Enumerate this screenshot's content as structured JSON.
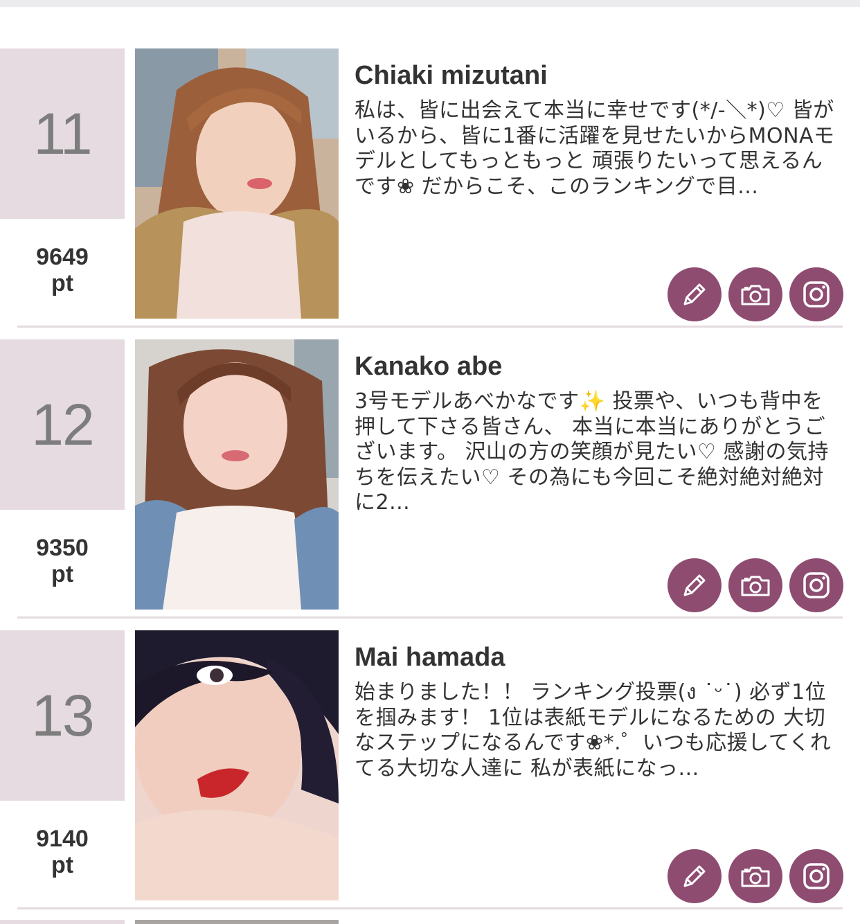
{
  "entries": [
    {
      "rank": "11",
      "points": "9649",
      "unit": "pt",
      "name": "Chiaki mizutani",
      "bio": "私は、皆に出会えて本当に幸せです(*/-＼*)♡ 皆がいるから、皆に1番に活躍を見せたいからMONAモデルとしてもっともっと 頑張りたいって思えるんです❀ だからこそ、このランキングで目..."
    },
    {
      "rank": "12",
      "points": "9350",
      "unit": "pt",
      "name": "Kanako abe",
      "bio": "3号モデルあべかなです✨ 投票や、いつも背中を押して下さる皆さん、 本当に本当にありがとうございます。 沢山の方の笑顔が見たい♡ 感謝の気持ちを伝えたい♡ その為にも今回こそ絶対絶対絶対に2..."
    },
    {
      "rank": "13",
      "points": "9140",
      "unit": "pt",
      "name": "Mai hamada",
      "bio": "始まりました！！ ランキング投票(ง ˙ᵕ˙) 必ず1位を掴みます！ 1位は表紙モデルになるための 大切なステップになるんです❀*.゜いつも応援してくれてる大切な人達に 私が表紙になっ..."
    }
  ],
  "icons": {
    "vote": "pencil-icon",
    "photos": "camera-icon",
    "instagram": "instagram-icon"
  },
  "colors": {
    "accent": "#8e4c71",
    "rank_bg": "#e5dbe1",
    "divider": "#e3dbe0",
    "rank_text": "#7d7d7d"
  }
}
